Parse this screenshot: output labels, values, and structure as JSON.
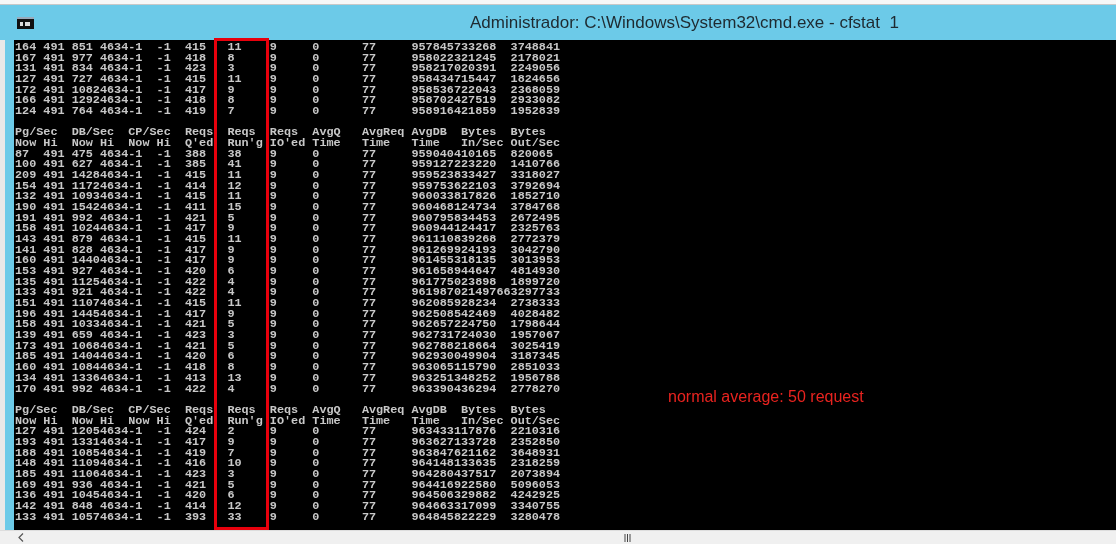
{
  "window": {
    "title": "Administrador: C:\\Windows\\System32\\cmd.exe - cfstat  1"
  },
  "console": {
    "blocks": [
      {
        "rows": [
          "164 491 851 4634-1  -1  415   11    9     0      77     957845733268  3748841",
          "167 491 977 4634-1  -1  418   8     9     0      77     958022321245  2178021",
          "131 491 834 4634-1  -1  423   3     9     0      77     958217020391  2249056",
          "127 491 727 4634-1  -1  415   11    9     0      77     958434715447  1824656",
          "172 491 10824634-1  -1  417   9     9     0      77     958536722043  2368059",
          "166 491 12924634-1  -1  418   8     9     0      77     958702427519  2933082",
          "124 491 764 4634-1  -1  419   7     9     0      77     958916421859  1952839"
        ]
      },
      {
        "header_lines": [
          "Pg/Sec  DB/Sec  CP/Sec  Reqs  Reqs  Reqs  AvgQ   AvgReq AvgDB  Bytes  Bytes",
          "Now Hi  Now Hi  Now Hi  Q'ed  Run'g IO'ed Time   Time   Time   In/Sec Out/Sec"
        ],
        "rows": [
          "87  491 475 4634-1  -1  388   38    9     0      77     959040410165  820065",
          "100 491 627 4634-1  -1  385   41    9     0      77     959127223220  1410766",
          "209 491 14284634-1  -1  415   11    9     0      77     959523833427  3318027",
          "154 491 11724634-1  -1  414   12    9     0      77     959753622103  3792694",
          "132 491 10934634-1  -1  415   11    9     0      77     960033817826  1852710",
          "190 491 15424634-1  -1  411   15    9     0      77     960468124734  3784768",
          "191 491 992 4634-1  -1  421   5     9     0      77     960795834453  2672495",
          "158 491 10244634-1  -1  417   9     9     0      77     960944124417  2325763",
          "143 491 879 4634-1  -1  415   11    9     0      77     961110839268  2772379",
          "141 491 828 4634-1  -1  417   9     9     0      77     961269924193  3042790",
          "160 491 14404634-1  -1  417   9     9     0      77     961455318135  3013953",
          "153 491 927 4634-1  -1  420   6     9     0      77     961658944647  4814930",
          "135 491 11254634-1  -1  422   4     9     0      77     961775023898  1899720",
          "133 491 921 4634-1  -1  422   4     9     0      77     961987021497663297733",
          "151 491 11074634-1  -1  415   11    9     0      77     962085928234  2738333",
          "196 491 14454634-1  -1  417   9     9     0      77     962508542469  4028482",
          "158 491 10334634-1  -1  421   5     9     0      77     962657224750  1798644",
          "139 491 659 4634-1  -1  423   3     9     0      77     962731724030  1957067",
          "173 491 10684634-1  -1  421   5     9     0      77     962788218664  3025419",
          "185 491 14044634-1  -1  420   6     9     0      77     962930049904  3187345",
          "160 491 10844634-1  -1  418   8     9     0      77     963065115790  2851033",
          "134 491 13364634-1  -1  413   13    9     0      77     963251348252  1956788",
          "170 491 992 4634-1  -1  422   4     9     0      77     963390436294  2778270"
        ]
      },
      {
        "header_lines": [
          "Pg/Sec  DB/Sec  CP/Sec  Reqs  Reqs  Reqs  AvgQ   AvgReq AvgDB  Bytes  Bytes",
          "Now Hi  Now Hi  Now Hi  Q'ed  Run'g IO'ed Time   Time   Time   In/Sec Out/Sec"
        ],
        "rows": [
          "127 491 12054634-1  -1  424   2     9     0      77     963433117876  2210316",
          "193 491 13314634-1  -1  417   9     9     0      77     963627133728  2352850",
          "188 491 10854634-1  -1  419   7     9     0      77     963847621162  3648931",
          "148 491 11094634-1  -1  416   10    9     0      77     964148133635  2318259",
          "185 491 11064634-1  -1  423   3     9     0      77     964280437517  2073894",
          "169 491 936 4634-1  -1  421   5     9     0      77     964416922580  5096053",
          "136 491 10454634-1  -1  420   6     9     0      77     964506329882  4242925",
          "142 491 848 4634-1  -1  414   12    9     0      77     964663317099  3340755",
          "133 491 10574634-1  -1  393   33    9     0      77     964845822229  3280478"
        ]
      }
    ]
  },
  "annotation": {
    "text": "normal average: 50 request"
  }
}
